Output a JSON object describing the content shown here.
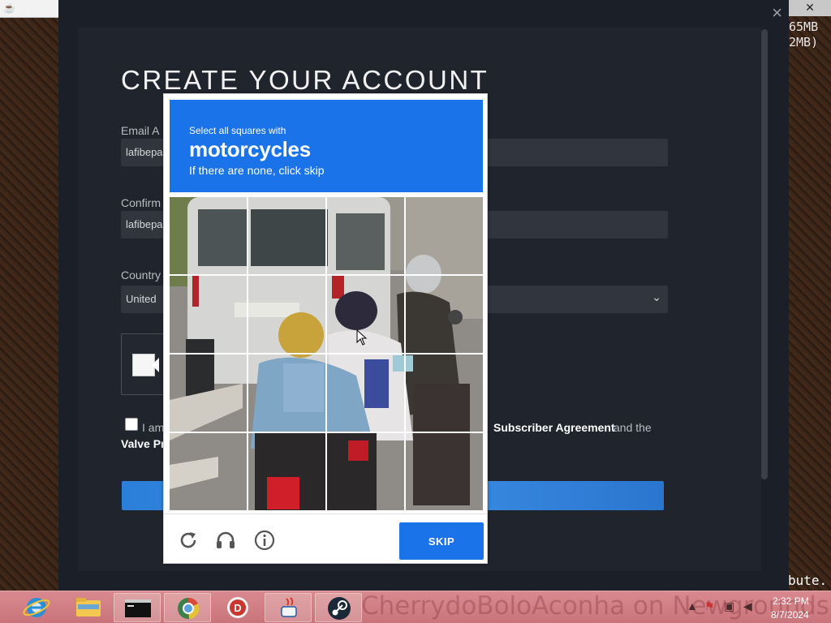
{
  "overlay": {
    "mem_line1": "65MB",
    "mem_line2": "2MB)",
    "corner_text": "bute."
  },
  "window": {
    "close_glyph": "✕",
    "steam_close_glyph": "×"
  },
  "signup": {
    "title": "CREATE YOUR ACCOUNT",
    "email_label": "Email A",
    "email_value": "lafibepa",
    "confirm_label": "Confirm",
    "confirm_value": "lafibepa",
    "country_label": "Country",
    "country_value": "United",
    "agree_prefix": "I am",
    "agree_subscriber": "Subscriber Agreement",
    "agree_and": "and the",
    "agree_privacy": "Valve Pr"
  },
  "captcha": {
    "instruction": "Select all squares with",
    "target": "motorcycles",
    "subtext": "If there are none, click skip",
    "skip_label": "SKIP"
  },
  "taskbar": {
    "watermark": "CherrydoBoloAconha on Newgrounds.",
    "time": "2:32 PM",
    "date": "8/7/2024",
    "accent": "#c9747a"
  }
}
